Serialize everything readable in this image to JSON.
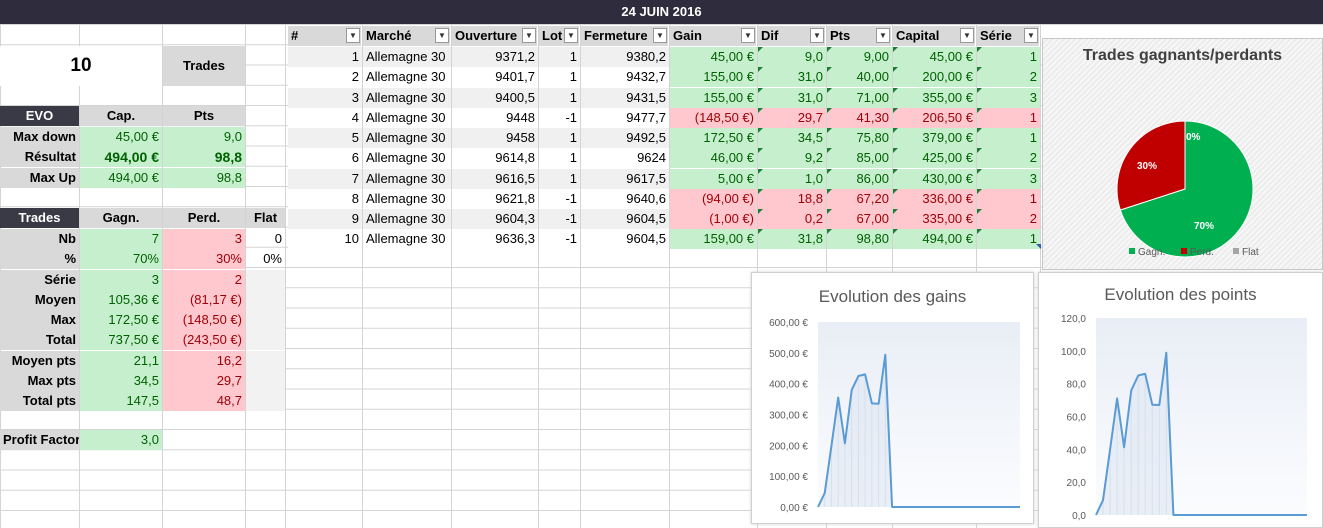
{
  "title": "24 JUIN 2016",
  "summary": {
    "count": "10",
    "count_label": "Trades"
  },
  "evo": {
    "header": [
      "EVO",
      "Cap.",
      "Pts"
    ],
    "rows": [
      {
        "label": "Max down",
        "cap": "45,00 €",
        "pts": "9,0"
      },
      {
        "label": "Résultat",
        "cap": "494,00 €",
        "pts": "98,8"
      },
      {
        "label": "Max Up",
        "cap": "494,00 €",
        "pts": "98,8"
      }
    ]
  },
  "trades_stats": {
    "header": [
      "Trades",
      "Gagn.",
      "Perd.",
      "Flat"
    ],
    "rows": [
      {
        "label": "Nb",
        "gagn": "7",
        "perd": "3",
        "flat": "0"
      },
      {
        "label": "%",
        "gagn": "70%",
        "perd": "30%",
        "flat": "0%"
      },
      {
        "label": "Série",
        "gagn": "3",
        "perd": "2",
        "flat": ""
      },
      {
        "label": "Moyen",
        "gagn": "105,36 €",
        "perd": "(81,17 €)",
        "flat": ""
      },
      {
        "label": "Max",
        "gagn": "172,50 €",
        "perd": "(148,50 €)",
        "flat": ""
      },
      {
        "label": "Total",
        "gagn": "737,50 €",
        "perd": "(243,50 €)",
        "flat": ""
      },
      {
        "label": "Moyen pts",
        "gagn": "21,1",
        "perd": "16,2",
        "flat": ""
      },
      {
        "label": "Max pts",
        "gagn": "34,5",
        "perd": "29,7",
        "flat": ""
      },
      {
        "label": "Total pts",
        "gagn": "147,5",
        "perd": "48,7",
        "flat": ""
      }
    ]
  },
  "profit_factor": {
    "label": "Profit Factor",
    "value": "3,0"
  },
  "main_table": {
    "columns": [
      "#",
      "Marché",
      "Ouverture",
      "Lot",
      "Fermeture",
      "Gain",
      "Dif",
      "Pts",
      "Capital",
      "Série"
    ],
    "rows": [
      {
        "n": "1",
        "marche": "Allemagne 30",
        "ouv": "9371,2",
        "lot": "1",
        "ferm": "9380,2",
        "gain": "45,00 €",
        "dif": "9,0",
        "pts": "9,00",
        "capital": "45,00 €",
        "serie": "1",
        "win": true
      },
      {
        "n": "2",
        "marche": "Allemagne 30",
        "ouv": "9401,7",
        "lot": "1",
        "ferm": "9432,7",
        "gain": "155,00 €",
        "dif": "31,0",
        "pts": "40,00",
        "capital": "200,00 €",
        "serie": "2",
        "win": true
      },
      {
        "n": "3",
        "marche": "Allemagne 30",
        "ouv": "9400,5",
        "lot": "1",
        "ferm": "9431,5",
        "gain": "155,00 €",
        "dif": "31,0",
        "pts": "71,00",
        "capital": "355,00 €",
        "serie": "3",
        "win": true
      },
      {
        "n": "4",
        "marche": "Allemagne 30",
        "ouv": "9448",
        "lot": "-1",
        "ferm": "9477,7",
        "gain": "(148,50 €)",
        "dif": "29,7",
        "pts": "41,30",
        "capital": "206,50 €",
        "serie": "1",
        "win": false
      },
      {
        "n": "5",
        "marche": "Allemagne 30",
        "ouv": "9458",
        "lot": "1",
        "ferm": "9492,5",
        "gain": "172,50 €",
        "dif": "34,5",
        "pts": "75,80",
        "capital": "379,00 €",
        "serie": "1",
        "win": true
      },
      {
        "n": "6",
        "marche": "Allemagne 30",
        "ouv": "9614,8",
        "lot": "1",
        "ferm": "9624",
        "gain": "46,00 €",
        "dif": "9,2",
        "pts": "85,00",
        "capital": "425,00 €",
        "serie": "2",
        "win": true
      },
      {
        "n": "7",
        "marche": "Allemagne 30",
        "ouv": "9616,5",
        "lot": "1",
        "ferm": "9617,5",
        "gain": "5,00 €",
        "dif": "1,0",
        "pts": "86,00",
        "capital": "430,00 €",
        "serie": "3",
        "win": true
      },
      {
        "n": "8",
        "marche": "Allemagne 30",
        "ouv": "9621,8",
        "lot": "-1",
        "ferm": "9640,6",
        "gain": "(94,00 €)",
        "dif": "18,8",
        "pts": "67,20",
        "capital": "336,00 €",
        "serie": "1",
        "win": false
      },
      {
        "n": "9",
        "marche": "Allemagne 30",
        "ouv": "9604,3",
        "lot": "-1",
        "ferm": "9604,5",
        "gain": "(1,00 €)",
        "dif": "0,2",
        "pts": "67,00",
        "capital": "335,00 €",
        "serie": "2",
        "win": false
      },
      {
        "n": "10",
        "marche": "Allemagne 30",
        "ouv": "9636,3",
        "lot": "-1",
        "ferm": "9604,5",
        "gain": "159,00 €",
        "dif": "31,8",
        "pts": "98,80",
        "capital": "494,00 €",
        "serie": "1",
        "win": true
      }
    ]
  },
  "colors": {
    "green_fill": "#c6efce",
    "green_text": "#006100",
    "red_fill": "#ffc7ce",
    "red_text": "#9c0006",
    "pie_win": "#00b050",
    "pie_loss": "#c00000",
    "pie_flat": "#a5a5a5",
    "line": "#5b9bd5",
    "title_bar": "#2f2c3e"
  },
  "chart_data": [
    {
      "type": "pie",
      "title": "Trades gagnants/perdants",
      "labels": [
        "Gagn.",
        "Perd.",
        "Flat"
      ],
      "values": [
        70,
        30,
        0
      ],
      "data_labels": [
        "70%",
        "30%",
        "0%"
      ],
      "legend": "bottom"
    },
    {
      "type": "area",
      "title": "Evolution des gains",
      "y_ticks": [
        "0,00 €",
        "100,00 €",
        "200,00 €",
        "300,00 €",
        "400,00 €",
        "500,00 €",
        "600,00 €"
      ],
      "ylim": [
        0,
        600
      ],
      "values": [
        0,
        45,
        200,
        355,
        206.5,
        379,
        425,
        430,
        336,
        335,
        494,
        0,
        0,
        0,
        0,
        0,
        0,
        0,
        0,
        0,
        0,
        0,
        0,
        0,
        0,
        0,
        0,
        0,
        0,
        0,
        0
      ],
      "grid": false
    },
    {
      "type": "area",
      "title": "Evolution des points",
      "y_ticks": [
        "0,0",
        "20,0",
        "40,0",
        "60,0",
        "80,0",
        "100,0",
        "120,0"
      ],
      "ylim": [
        0,
        120
      ],
      "values": [
        0,
        9,
        40,
        71,
        41.3,
        75.8,
        85,
        86,
        67.2,
        67,
        98.8,
        0,
        0,
        0,
        0,
        0,
        0,
        0,
        0,
        0,
        0,
        0,
        0,
        0,
        0,
        0,
        0,
        0,
        0,
        0,
        0
      ],
      "grid": false
    }
  ]
}
